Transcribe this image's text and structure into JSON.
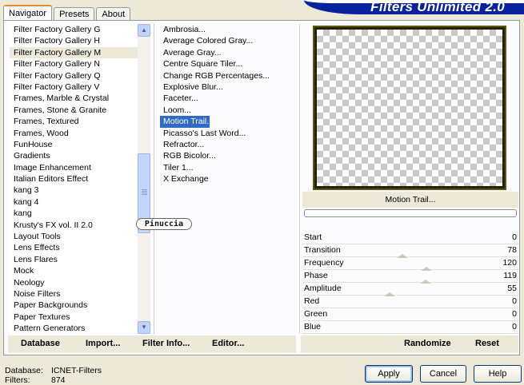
{
  "app": {
    "title": "Filters Unlimited 2.0"
  },
  "tabs": [
    {
      "label": "Navigator",
      "active": true
    },
    {
      "label": "Presets",
      "active": false
    },
    {
      "label": "About",
      "active": false
    }
  ],
  "categories": {
    "selected": "Filter Factory Gallery M",
    "items": [
      "Filter Factory Gallery G",
      "Filter Factory Gallery H",
      "Filter Factory Gallery M",
      "Filter Factory Gallery N",
      "Filter Factory Gallery Q",
      "Filter Factory Gallery V",
      "Frames, Marble & Crystal",
      "Frames, Stone & Granite",
      "Frames, Textured",
      "Frames, Wood",
      "FunHouse",
      "Gradients",
      "Image Enhancement",
      "Italian Editors Effect",
      "kang 3",
      "kang 4",
      "kang",
      "Krusty's FX vol. II 2.0",
      "Layout Tools",
      "Lens Effects",
      "Lens Flares",
      "Mock",
      "Neology",
      "Noise Filters",
      "Paper Backgrounds",
      "Paper Textures",
      "Pattern Generators"
    ]
  },
  "filters": {
    "selected": "Motion Trail...",
    "items": [
      "Ambrosia...",
      "Average Colored Gray...",
      "Average Gray...",
      "Centre Square Tiler...",
      "Change RGB Percentages...",
      "Explosive Blur...",
      "Faceter...",
      "Loom...",
      "Motion Trail...",
      "Picasso's Last Word...",
      "Refractor...",
      "RGB Bicolor...",
      "Tiler 1...",
      "X Exchange"
    ]
  },
  "watermark": "Pinuccia",
  "preview": {
    "filter_name": "Motion Trail..."
  },
  "parameters": [
    {
      "label": "Start",
      "value": "0",
      "level": 0
    },
    {
      "label": "Transition",
      "value": "78",
      "level": 0.306
    },
    {
      "label": "Frequency",
      "value": "120",
      "level": 0.471
    },
    {
      "label": "Phase",
      "value": "119",
      "level": 0.467
    },
    {
      "label": "Amplitude",
      "value": "55",
      "level": 0.216
    },
    {
      "label": "Red",
      "value": "0",
      "level": 0
    },
    {
      "label": "Green",
      "value": "0",
      "level": 0
    },
    {
      "label": "Blue",
      "value": "0",
      "level": 0
    }
  ],
  "left_buttons": {
    "database": "Database",
    "import": "Import...",
    "filter_info": "Filter Info...",
    "editor": "Editor..."
  },
  "right_buttons": {
    "randomize": "Randomize",
    "reset": "Reset"
  },
  "footer": {
    "database_label": "Database:",
    "database_value": "ICNET-Filters",
    "filters_label": "Filters:",
    "filters_value": "874"
  },
  "dialog_buttons": {
    "apply": "Apply",
    "cancel": "Cancel",
    "help": "Help"
  }
}
